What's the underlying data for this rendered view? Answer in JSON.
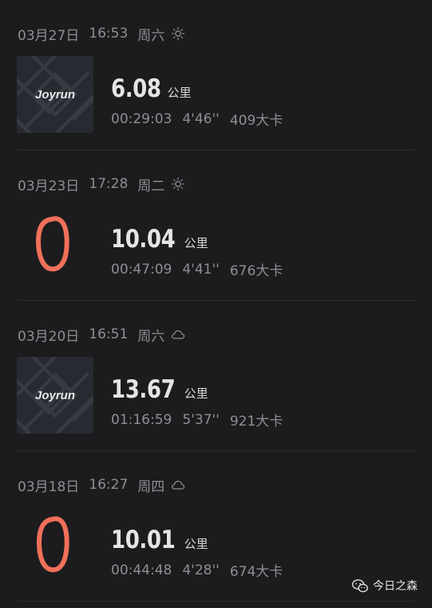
{
  "runs": [
    {
      "date": "03月27日",
      "time": "16:53",
      "weekday": "周六",
      "weather_icon": "sun-icon",
      "thumb": "joyrun-logo",
      "thumb_text": "Joyrun",
      "distance": "6.08",
      "unit": "公里",
      "duration": "00:29:03",
      "pace": "4'46''",
      "calories": "409大卡"
    },
    {
      "date": "03月23日",
      "time": "17:28",
      "weekday": "周二",
      "weather_icon": "sun-icon",
      "thumb": "track-loop",
      "thumb_text": "",
      "distance": "10.04",
      "unit": "公里",
      "duration": "00:47:09",
      "pace": "4'41''",
      "calories": "676大卡"
    },
    {
      "date": "03月20日",
      "time": "16:51",
      "weekday": "周六",
      "weather_icon": "cloud-icon",
      "thumb": "joyrun-logo",
      "thumb_text": "Joyrun",
      "distance": "13.67",
      "unit": "公里",
      "duration": "01:16:59",
      "pace": "5'37''",
      "calories": "921大卡"
    },
    {
      "date": "03月18日",
      "time": "16:27",
      "weekday": "周四",
      "weather_icon": "cloud-icon",
      "thumb": "track-loop",
      "thumb_text": "",
      "distance": "10.01",
      "unit": "公里",
      "duration": "00:44:48",
      "pace": "4'28''",
      "calories": "674大卡"
    }
  ],
  "watermark": {
    "icon": "wechat-icon",
    "text": "今日之森"
  },
  "colors": {
    "background": "#1c1c1e",
    "track": "#f0705a",
    "text_primary": "#e5e5e5",
    "text_secondary": "#8e8e93"
  }
}
